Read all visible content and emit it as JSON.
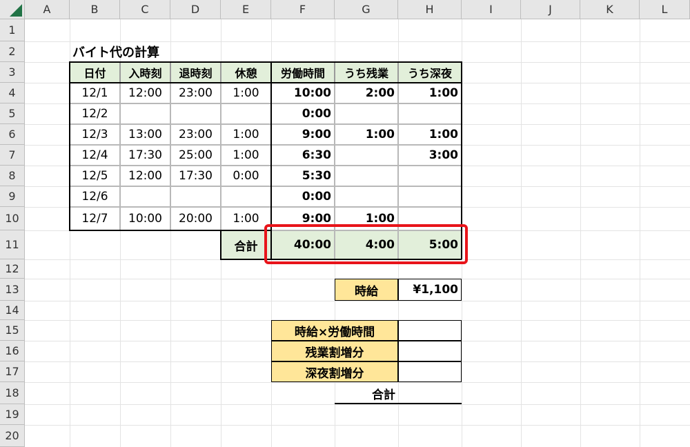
{
  "sheet": {
    "columns": [
      "A",
      "B",
      "C",
      "D",
      "E",
      "F",
      "G",
      "H",
      "I",
      "J",
      "K",
      "L"
    ],
    "rows": [
      "1",
      "2",
      "3",
      "4",
      "5",
      "6",
      "7",
      "8",
      "9",
      "10",
      "11",
      "12",
      "13",
      "14",
      "15",
      "16",
      "17",
      "18",
      "19",
      "20"
    ]
  },
  "title": "バイト代の計算",
  "table": {
    "headers": [
      "日付",
      "入時刻",
      "退時刻",
      "休憩",
      "労働時間",
      "うち残業",
      "うち深夜"
    ],
    "rows": [
      [
        "12/1",
        "12:00",
        "23:00",
        "1:00",
        "10:00",
        "2:00",
        "1:00"
      ],
      [
        "12/2",
        "",
        "",
        "",
        "0:00",
        "",
        ""
      ],
      [
        "12/3",
        "13:00",
        "23:00",
        "1:00",
        "9:00",
        "1:00",
        "1:00"
      ],
      [
        "12/4",
        "17:30",
        "25:00",
        "1:00",
        "6:30",
        "",
        "3:00"
      ],
      [
        "12/5",
        "12:00",
        "17:30",
        "0:00",
        "5:30",
        "",
        ""
      ],
      [
        "12/6",
        "",
        "",
        "",
        "0:00",
        "",
        ""
      ],
      [
        "12/7",
        "10:00",
        "20:00",
        "1:00",
        "9:00",
        "1:00",
        ""
      ]
    ],
    "total_label": "合計",
    "totals": [
      "40:00",
      "4:00",
      "5:00"
    ]
  },
  "wage": {
    "label": "時給",
    "value": "¥1,100"
  },
  "calc": {
    "labels": [
      "時給×労働時間",
      "残業割増分",
      "深夜割増分"
    ],
    "values": [
      "",
      "",
      ""
    ],
    "total_label": "合計"
  },
  "colors": {
    "header_fill": "#e2efda",
    "label_fill": "#ffe699",
    "highlight_border": "#e8141a",
    "excel_green": "#217346"
  }
}
